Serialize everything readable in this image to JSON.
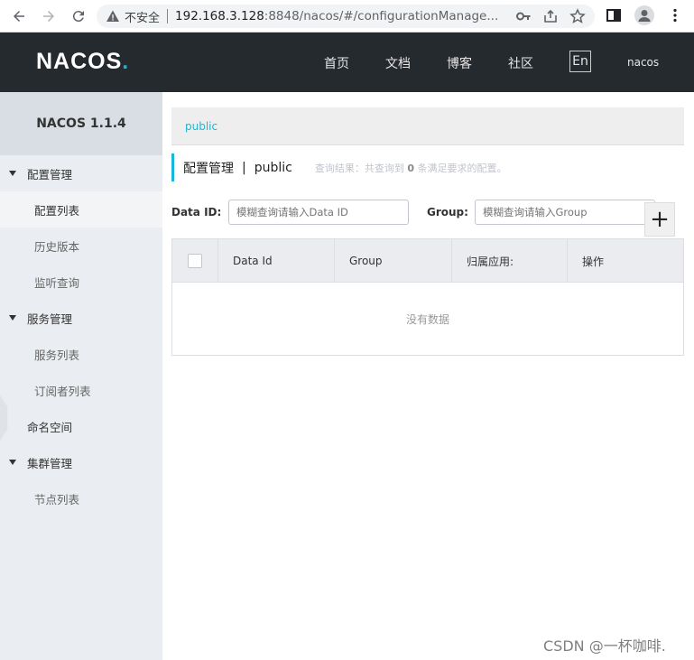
{
  "browser": {
    "security_label": "不安全",
    "url_host": "192.168.3.128",
    "url_rest": ":8848/nacos/#/configurationManage..."
  },
  "header": {
    "logo_text": "NACOS",
    "logo_dot": ".",
    "nav": [
      {
        "label": "首页"
      },
      {
        "label": "文档"
      },
      {
        "label": "博客"
      },
      {
        "label": "社区"
      }
    ],
    "lang_label": "En",
    "user": "nacos"
  },
  "sidebar": {
    "title": "NACOS 1.1.4",
    "groups": [
      {
        "label": "配置管理",
        "items": [
          {
            "label": "配置列表",
            "active": true
          },
          {
            "label": "历史版本"
          },
          {
            "label": "监听查询"
          }
        ]
      },
      {
        "label": "服务管理",
        "items": [
          {
            "label": "服务列表"
          },
          {
            "label": "订阅者列表"
          }
        ]
      },
      {
        "label": "命名空间"
      },
      {
        "label": "集群管理",
        "items": [
          {
            "label": "节点列表"
          }
        ]
      }
    ]
  },
  "main": {
    "namespace_tab": "public",
    "page_title": "配置管理",
    "title_sep": "|",
    "namespace_name": "public",
    "query_result_prefix": "查询结果：共查询到",
    "query_result_count": "0",
    "query_result_suffix": "条满足要求的配置。",
    "filter": {
      "data_id_label": "Data ID:",
      "data_id_placeholder": "模糊查询请输入Data ID",
      "group_label": "Group:",
      "group_placeholder": "模糊查询请输入Group"
    },
    "add_label": "+",
    "table": {
      "columns": [
        "Data Id",
        "Group",
        "归属应用:",
        "操作"
      ],
      "empty_text": "没有数据"
    }
  },
  "watermark": "CSDN @一杯咖啡."
}
